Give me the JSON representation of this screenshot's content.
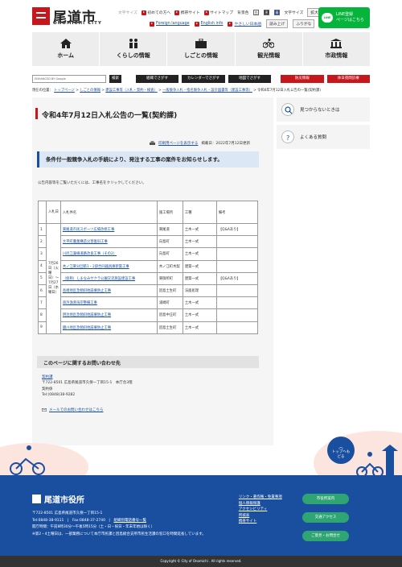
{
  "header": {
    "logo_ja": "尾道市",
    "logo_en": "ONOMICHI CITY",
    "top_links": [
      "文字サイズ",
      "初めての方へ",
      "携帯サイト",
      "サイトマップ"
    ],
    "bg_color_label": "背景色",
    "bg_options": [
      "白",
      "黒",
      "青"
    ],
    "font_size_label": "文字サイズ",
    "font_size_options": [
      "拡大",
      "標準"
    ],
    "lang_links": [
      "Foreign language",
      "English info",
      "やさしい日本語"
    ],
    "read_aloud": "読み上げ",
    "furigana": "ふりがな",
    "line_btn": "LINE登録\nページはこちら",
    "line_icon": "LINE"
  },
  "nav": {
    "items": [
      {
        "label": "ホーム",
        "icon": "home-icon"
      },
      {
        "label": "くらしの情報",
        "icon": "family-icon"
      },
      {
        "label": "しごとの情報",
        "icon": "briefcase-icon"
      },
      {
        "label": "観光情報",
        "icon": "bicycle-icon"
      },
      {
        "label": "市政情報",
        "icon": "building-icon"
      }
    ]
  },
  "search": {
    "placeholder": "ENHANCED BY Google",
    "button": "検索",
    "buttons": [
      "組織でさがす",
      "カレンダーでさがす",
      "地図でさがす"
    ],
    "red_buttons": [
      "防災情報",
      "休日夜間診療"
    ]
  },
  "breadcrumb": {
    "prefix": "現在の位置：",
    "items": [
      "トップページ",
      "しごとの情報",
      "建設工事等（入札・契約・検査）",
      "一般競争入札・指名競争入札・設計図書等（建設工事等）"
    ],
    "current": "令和4年7月12日入札公告の一覧(契約課)"
  },
  "page": {
    "title": "令和4年7月12日入札公告の一覧(契約課)",
    "print": "印刷用ページを表示する",
    "published": "掲載日：2022年7月12日更新",
    "notice": "条件付一般競争入札の手続により、発注する工事の案件をお知らせします。",
    "intro": "公告内容等をご覧いただくには、工事名をクリックしてください。"
  },
  "table": {
    "headers": [
      "入札日",
      "入札件名",
      "施工場所",
      "工種",
      "備考"
    ],
    "date_cell": "7月26日（火曜日）〜7月27日（水曜日）",
    "rows": [
      {
        "no": "1",
        "name": "東尾道市民スポーツ広場改修工事",
        "place": "東尾道",
        "type": "土木一式",
        "note": "【Q&Aあり】"
      },
      {
        "no": "2",
        "name": "大平町農業構造災害復旧工事",
        "place": "向島町",
        "type": "土木一式",
        "note": ""
      },
      {
        "no": "3",
        "name": "川尻江兼線道路改良工事（その2）",
        "place": "向島町",
        "type": "土木一式",
        "note": ""
      },
      {
        "no": "4",
        "name": "木ノ江東分団第1・2部合同器具庫新築工事",
        "place": "木ノ江町木梨",
        "type": "建築一式",
        "note": ""
      },
      {
        "no": "5",
        "name": "（仮称）しまなみサクラ公園交流施設建設工事",
        "place": "東御所町",
        "type": "建築一式",
        "note": "【Q&Aあり】"
      },
      {
        "no": "6",
        "name": "長崎地区急傾斜地崩壊防止工事",
        "place": "因島土生町",
        "type": "法面処理",
        "note": ""
      },
      {
        "no": "7",
        "name": "串浜漁港海岸整備工事",
        "place": "浦崎町",
        "type": "土木一式",
        "note": ""
      },
      {
        "no": "8",
        "name": "明治地区急傾斜地崩壊防止工事",
        "place": "因島中庄町",
        "type": "土木一式",
        "note": ""
      },
      {
        "no": "9",
        "name": "鏡川地区急傾斜地崩壊防止工事",
        "place": "因島土生町",
        "type": "土木一式",
        "note": ""
      }
    ]
  },
  "contact": {
    "heading": "このページに関するお問い合わせ先",
    "dept": "契約課",
    "address": "〒722-8501 広島県尾道市久保一丁目15-1　本庁舎3階",
    "section": "契約係",
    "tel": "Tel:(0848)38-9282",
    "mail": "メールでのお問い合わせはこちら"
  },
  "side": {
    "item1": "見つからないときは",
    "item2": "よくある質問"
  },
  "footer": {
    "name": "尾道市役所",
    "address": "〒722-8501 広島県尾道市久保一丁目15-1",
    "tel": "Tel:0848-38-9111",
    "fax": "Fax:0848-37-2740",
    "phone_list": "組織別電話番号一覧",
    "hours": "開庁時間：午前8時30分～午後5時15分（土・日・祝日・年末年始は除く）",
    "note": "※第2・4土曜日は、一部業務について本庁市民課と因島総合支所市民生活課の窓口を時間延長しています。",
    "links": [
      "リンク・著作権・免責事項",
      "個人情報保護",
      "アクセシビリティ",
      "所城表",
      "携帯サイト"
    ],
    "buttons": [
      "市役所案内",
      "交通アクセス",
      "ご意見・お問合せ"
    ],
    "copyright": "Copyright © City of Onomichi . All rights reserved.",
    "totop": "トップへもどる"
  }
}
